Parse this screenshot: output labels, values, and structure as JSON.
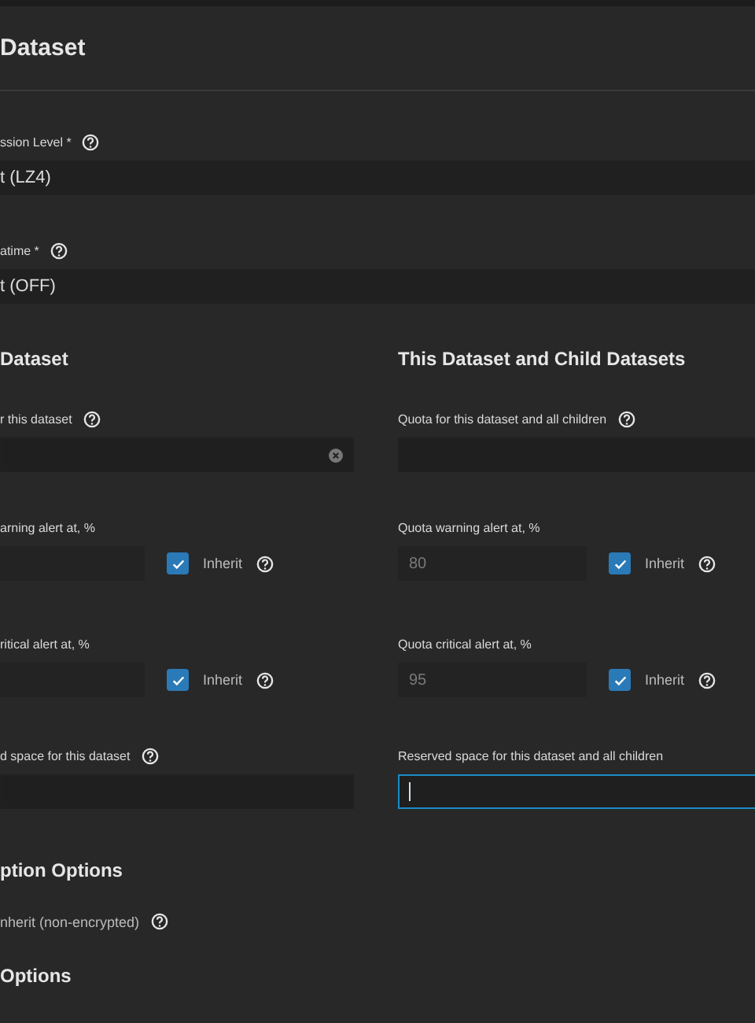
{
  "header": {
    "title": "Dataset"
  },
  "selects": [
    {
      "label": "ssion Level",
      "required_mark": "*",
      "value": "t (LZ4)"
    },
    {
      "label": "atime",
      "required_mark": "*",
      "value": "t (OFF)"
    }
  ],
  "quota_columns": [
    {
      "title": "Dataset",
      "quota": {
        "label": "r this dataset",
        "help": true,
        "clearable": true
      },
      "alerts": [
        {
          "label": "arning alert at, %",
          "inherit": {
            "label": "Inherit",
            "checked": true
          }
        },
        {
          "label": "ritical alert at, %",
          "inherit": {
            "label": "Inherit",
            "checked": true
          }
        }
      ],
      "reserved": {
        "label": "d space for this dataset",
        "help": true,
        "focused": false
      }
    },
    {
      "title": "This Dataset and Child Datasets",
      "quota": {
        "label": "Quota for this dataset and all children",
        "help": true,
        "clearable": false
      },
      "alerts": [
        {
          "label": "Quota warning alert at, %",
          "value": "80",
          "inherit": {
            "label": "Inherit",
            "checked": true
          }
        },
        {
          "label": "Quota critical alert at, %",
          "value": "95",
          "inherit": {
            "label": "Inherit",
            "checked": true
          }
        }
      ],
      "reserved": {
        "label": "Reserved space for this dataset and all children",
        "help": false,
        "focused": true
      }
    }
  ],
  "encryption": {
    "title": "ption Options",
    "option": "nherit (non-encrypted)"
  },
  "next_section": {
    "title": "Options"
  }
}
